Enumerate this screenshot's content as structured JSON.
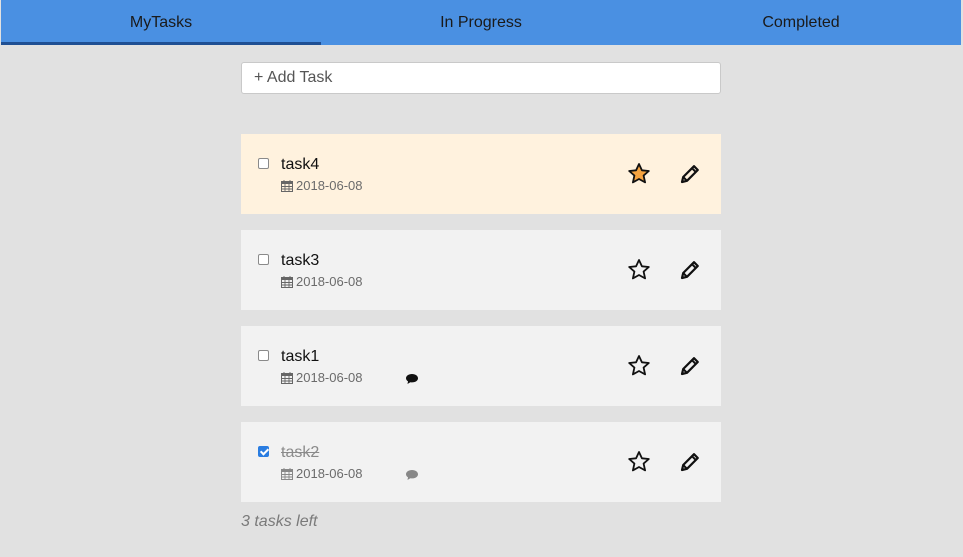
{
  "nav": {
    "tabs": [
      {
        "label": "MyTasks",
        "active": true
      },
      {
        "label": "In Progress",
        "active": false
      },
      {
        "label": "Completed",
        "active": false
      }
    ]
  },
  "add_task": {
    "placeholder": "+ Add Task"
  },
  "tasks": [
    {
      "title": "task4",
      "date": "2018-06-08",
      "starred": true,
      "completed": false,
      "has_comment": false
    },
    {
      "title": "task3",
      "date": "2018-06-08",
      "starred": false,
      "completed": false,
      "has_comment": false
    },
    {
      "title": "task1",
      "date": "2018-06-08",
      "starred": false,
      "completed": false,
      "has_comment": true
    },
    {
      "title": "task2",
      "date": "2018-06-08",
      "starred": false,
      "completed": true,
      "has_comment": true
    }
  ],
  "footer": {
    "tasks_left": "3 tasks left"
  },
  "colors": {
    "nav_bg": "#4a90e2",
    "star_fill": "#f5a340",
    "starred_bg": "#fff2de",
    "check_blue": "#2a7de1"
  },
  "icons": [
    "calendar-icon",
    "comment-icon",
    "star-icon",
    "pencil-icon"
  ]
}
